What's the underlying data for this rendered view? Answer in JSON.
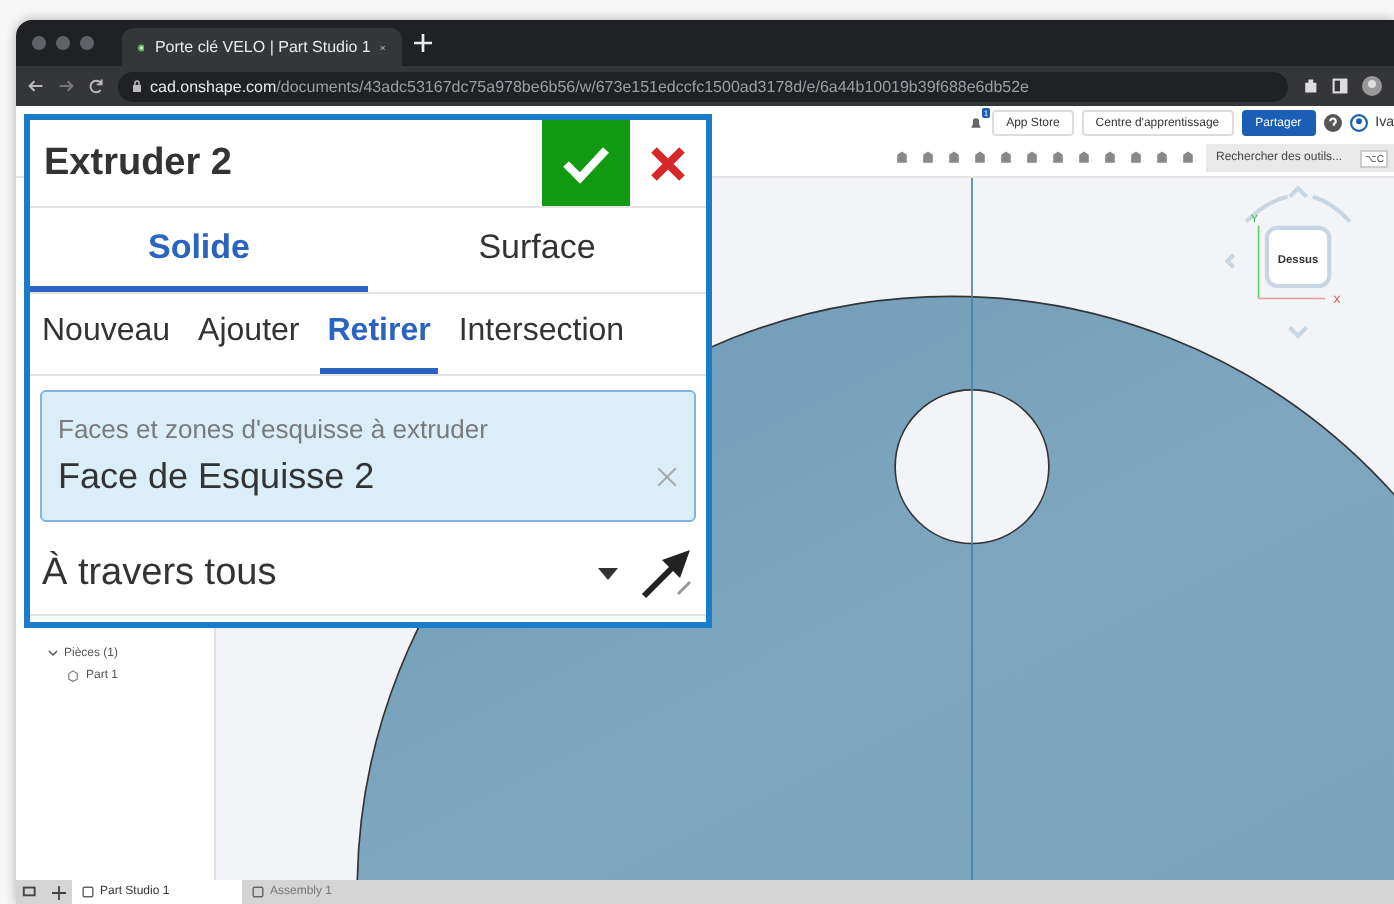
{
  "browser": {
    "tab_title": "Porte clé VELO | Part Studio 1",
    "url_host": "cad.onshape.com",
    "url_path": "/documents/43adc53167dc75a978be6b56/w/673e151edccfc1500ad3178d/e/6a44b10019b39f688e6db52e"
  },
  "header": {
    "notification_count": "1",
    "buttons": [
      {
        "label": "App Store",
        "kind": "plain"
      },
      {
        "label": "Centre d'apprentissage",
        "kind": "plain"
      },
      {
        "label": "Partager",
        "kind": "primary"
      }
    ],
    "user_name": "Iva"
  },
  "toolbar": {
    "search_placeholder": "Rechercher des outils...",
    "shortcut": "⌥C"
  },
  "feature_tree": {
    "items": [
      {
        "label": "Pièces (1)",
        "expanded": true,
        "children": [
          {
            "label": "Part 1"
          }
        ]
      }
    ]
  },
  "dialog": {
    "title": "Extruder 2",
    "tabs": [
      {
        "label": "Solide",
        "selected": true
      },
      {
        "label": "Surface",
        "selected": false
      }
    ],
    "operations": [
      {
        "label": "Nouveau",
        "selected": false
      },
      {
        "label": "Ajouter",
        "selected": false
      },
      {
        "label": "Retirer",
        "selected": true
      },
      {
        "label": "Intersection",
        "selected": false
      }
    ],
    "selection_field": {
      "label": "Faces et zones d'esquisse à extruder",
      "value": "Face de Esquisse 2"
    },
    "end_type": "À travers tous"
  },
  "view_cube": {
    "face": "Dessus",
    "axes": [
      "Y",
      "X"
    ]
  },
  "bottom_tabs": [
    {
      "label": "Part Studio 1",
      "selected": true
    },
    {
      "label": "Assembly 1",
      "selected": false
    }
  ]
}
